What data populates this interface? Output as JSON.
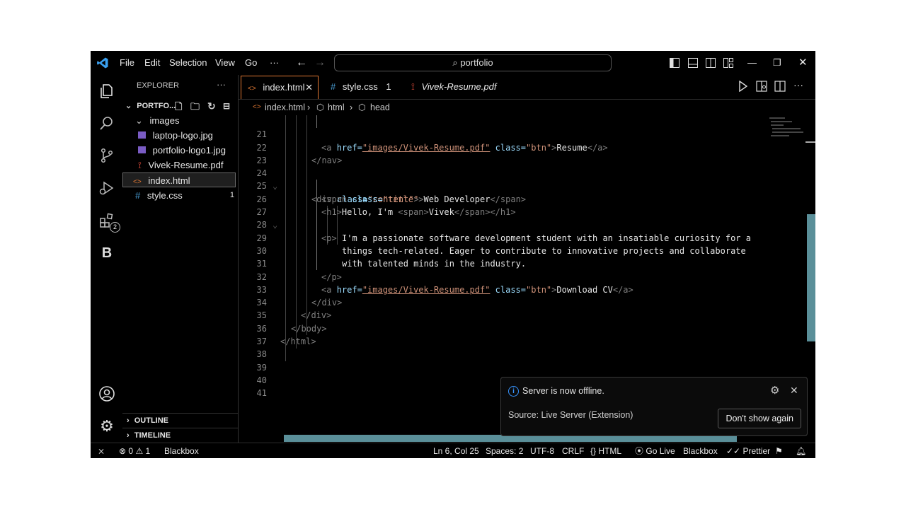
{
  "title_bar": {
    "menu": [
      "File",
      "Edit",
      "Selection",
      "View",
      "Go",
      "···"
    ],
    "search_text": "portfolio"
  },
  "sidebar": {
    "header": "EXPLORER",
    "more": "···",
    "folder": "PORTFO...",
    "tree": [
      {
        "label": "images",
        "type": "folder"
      },
      {
        "label": "laptop-logo.jpg",
        "type": "image"
      },
      {
        "label": "portfolio-logo1.jpg",
        "type": "image"
      },
      {
        "label": "Vivek-Resume.pdf",
        "type": "pdf"
      },
      {
        "label": "index.html",
        "type": "html"
      },
      {
        "label": "style.css",
        "type": "css",
        "badge": "1"
      }
    ],
    "outline": "OUTLINE",
    "timeline": "TIMELINE"
  },
  "tabs": [
    {
      "label": "index.html",
      "icon": "<>"
    },
    {
      "label": "style.css",
      "icon": "#",
      "badge": "1"
    },
    {
      "label": "Vivek-Resume.pdf",
      "icon": "pdf"
    }
  ],
  "breadcrumb": [
    "index.html",
    "html",
    "head"
  ],
  "code": {
    "line_numbers": [
      "21",
      "22",
      "23",
      "24",
      "25",
      "26",
      "27",
      "28",
      "29",
      "30",
      "31",
      "32",
      "33",
      "34",
      "35",
      "36",
      "37",
      "38",
      "39",
      "40",
      "41"
    ],
    "l21": {
      "a_open": "<a ",
      "href": "href=",
      "href_val": "\"images/Vivek-Resume.pdf\"",
      "cls": " class=",
      "cls_val": "\"btn\"",
      "close": ">",
      "text": "Resume",
      "end": "</a>"
    },
    "l22": "</nav>",
    "l24": {
      "open": "<div ",
      "cls": "class=",
      "cls_val": "\"content\"",
      "close": ">"
    },
    "l25": {
      "open": "<span ",
      "cls": "class=",
      "cls_val": "\"title\"",
      "close": ">",
      "text": "Web Developer",
      "end": "</span>"
    },
    "l26": {
      "open": "<h1>",
      "text": "Hello, I'm ",
      "span_open": "<span>",
      "name": "Vivek",
      "span_end": "</span>",
      "end": "</h1>"
    },
    "l27": "<p>",
    "l28": "I'm a passionate software development student with an insatiable curiosity for a",
    "l29": "things tech-related. Eager to contribute to innovative projects and collaborate",
    "l30": "with talented minds in the industry.",
    "l31": "</p>",
    "l32": {
      "a_open": "<a ",
      "href": "href=",
      "href_val": "\"images/Vivek-Resume.pdf\"",
      "cls": " class=",
      "cls_val": "\"btn\"",
      "close": ">",
      "text": "Download CV",
      "end": "</a>"
    },
    "l33": "</div>",
    "l34": "</div>",
    "l35": "</body>",
    "l36": "</html>"
  },
  "notification": {
    "message": "Server is now offline.",
    "source": "Source: Live Server (Extension)",
    "button": "Don't show again"
  },
  "status_bar": {
    "errors": "0",
    "warnings": "1",
    "blackbox_left": "Blackbox",
    "position": "Ln 6, Col 25",
    "spaces": "Spaces: 2",
    "encoding": "UTF-8",
    "eol": "CRLF",
    "language": "HTML",
    "golive": "Go Live",
    "blackbox_right": "Blackbox",
    "prettier": "Prettier"
  },
  "activity_badge": "2",
  "colors": {
    "accent": "#0078d4",
    "background": "#000000",
    "folder_highlight": "#1f1f1f"
  }
}
